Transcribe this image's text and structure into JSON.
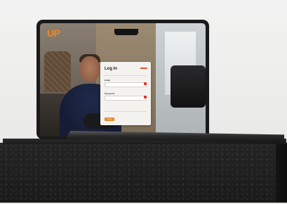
{
  "screen": {
    "logo_text": "UP",
    "login": {
      "title": "Log In",
      "email_label": "Email",
      "password_label": "Password",
      "submit_label": "Log in"
    }
  },
  "colors": {
    "accent": "#e98a2b",
    "marker": "#d63a2f"
  }
}
